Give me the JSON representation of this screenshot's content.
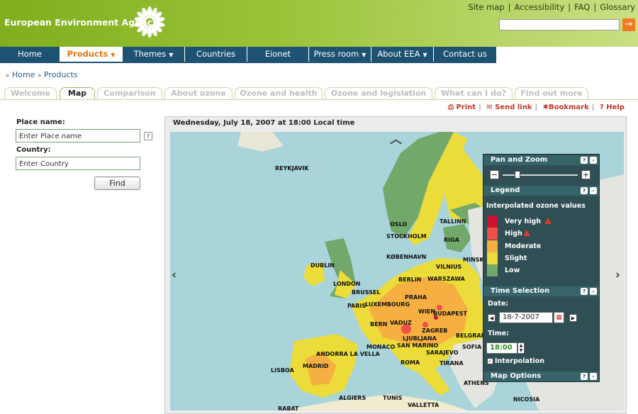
{
  "header": {
    "org_name": "European Environment Agency",
    "top_links": [
      "Site map",
      "Accessibility",
      "FAQ",
      "Glossary"
    ],
    "search_button": "→",
    "brand_color": "#8ab52c"
  },
  "nav": {
    "items": [
      {
        "label": "Home",
        "caret": ""
      },
      {
        "label": "Products",
        "caret": "▼"
      },
      {
        "label": "Themes",
        "caret": "▼"
      },
      {
        "label": "Countries",
        "caret": ""
      },
      {
        "label": "Eionet",
        "caret": ""
      },
      {
        "label": "Press room",
        "caret": "▼"
      },
      {
        "label": "About EEA",
        "caret": "▼"
      },
      {
        "label": "Contact us",
        "caret": ""
      }
    ],
    "active": "Products"
  },
  "breadcrumb": {
    "items": [
      "Home",
      "Products"
    ]
  },
  "tabs": [
    "Welcome",
    "Map",
    "Comparison",
    "About ozone",
    "Ozone and health",
    "Ozone and legislation",
    "What can I do?",
    "Find out more"
  ],
  "active_tab": "Map",
  "tools": {
    "print": "Print",
    "send_link": "Send link",
    "bookmark": "Bookmark",
    "help": "Help"
  },
  "left_panel": {
    "place_label": "Place name:",
    "place_value": "Enter Place name",
    "country_label": "Country:",
    "country_value": "Enter Country",
    "help": "?",
    "find_button": "Find"
  },
  "map": {
    "timestamp": "Wednesday, July 18, 2007 at 18:00 Local time",
    "cities": [
      "REYKJAVIK",
      "OSLO",
      "TALLINN",
      "STOCKHOLM",
      "RIGA",
      "KØBENHAVN",
      "VILNIUS",
      "DUBLIN",
      "MINSK",
      "BERLIN",
      "WARSZAWA",
      "LONDON",
      "BRUSSEL",
      "PRAHA",
      "PARIS",
      "LUXEMBOURG",
      "WIEN",
      "BUDAPEST",
      "BERN",
      "VADUZ",
      "ZAGREB",
      "LJUBLJANA",
      "BELGRADE",
      "MONACO",
      "SAN MARINO",
      "SARAJEVO",
      "SOFIA",
      "ANDORRA LA VELLA",
      "ROMA",
      "TIRANA",
      "MADRID",
      "LISBOA",
      "ATHENS",
      "ALGIERS",
      "TUNIS",
      "NICOSIA",
      "VALLETTA",
      "RABAT"
    ]
  },
  "panel": {
    "pan_zoom_title": "Pan and Zoom",
    "zoom_minus": "−",
    "zoom_plus": "+",
    "zoom_level": 0.2,
    "legend_title": "Legend",
    "legend_subtitle": "Interpolated ozone values",
    "legend_items": [
      {
        "label": "Very high",
        "color": "#c8142f",
        "warning": true
      },
      {
        "label": "High",
        "color": "#ef4f48",
        "warning": true
      },
      {
        "label": "Moderate",
        "color": "#f6b042",
        "warning": false
      },
      {
        "label": "Slight",
        "color": "#ecdc3a",
        "warning": false
      },
      {
        "label": "Low",
        "color": "#73a86b",
        "warning": false
      }
    ],
    "time_title": "Time Selection",
    "date_label": "Date:",
    "date_value": "18-7-2007",
    "time_label": "Time:",
    "time_value": "18:00",
    "interpolation_label": "Interpolation",
    "interpolation_checked": true,
    "map_options_title": "Map Options",
    "help": "?",
    "minimize": "–",
    "prev": "◀",
    "next": "▶"
  }
}
